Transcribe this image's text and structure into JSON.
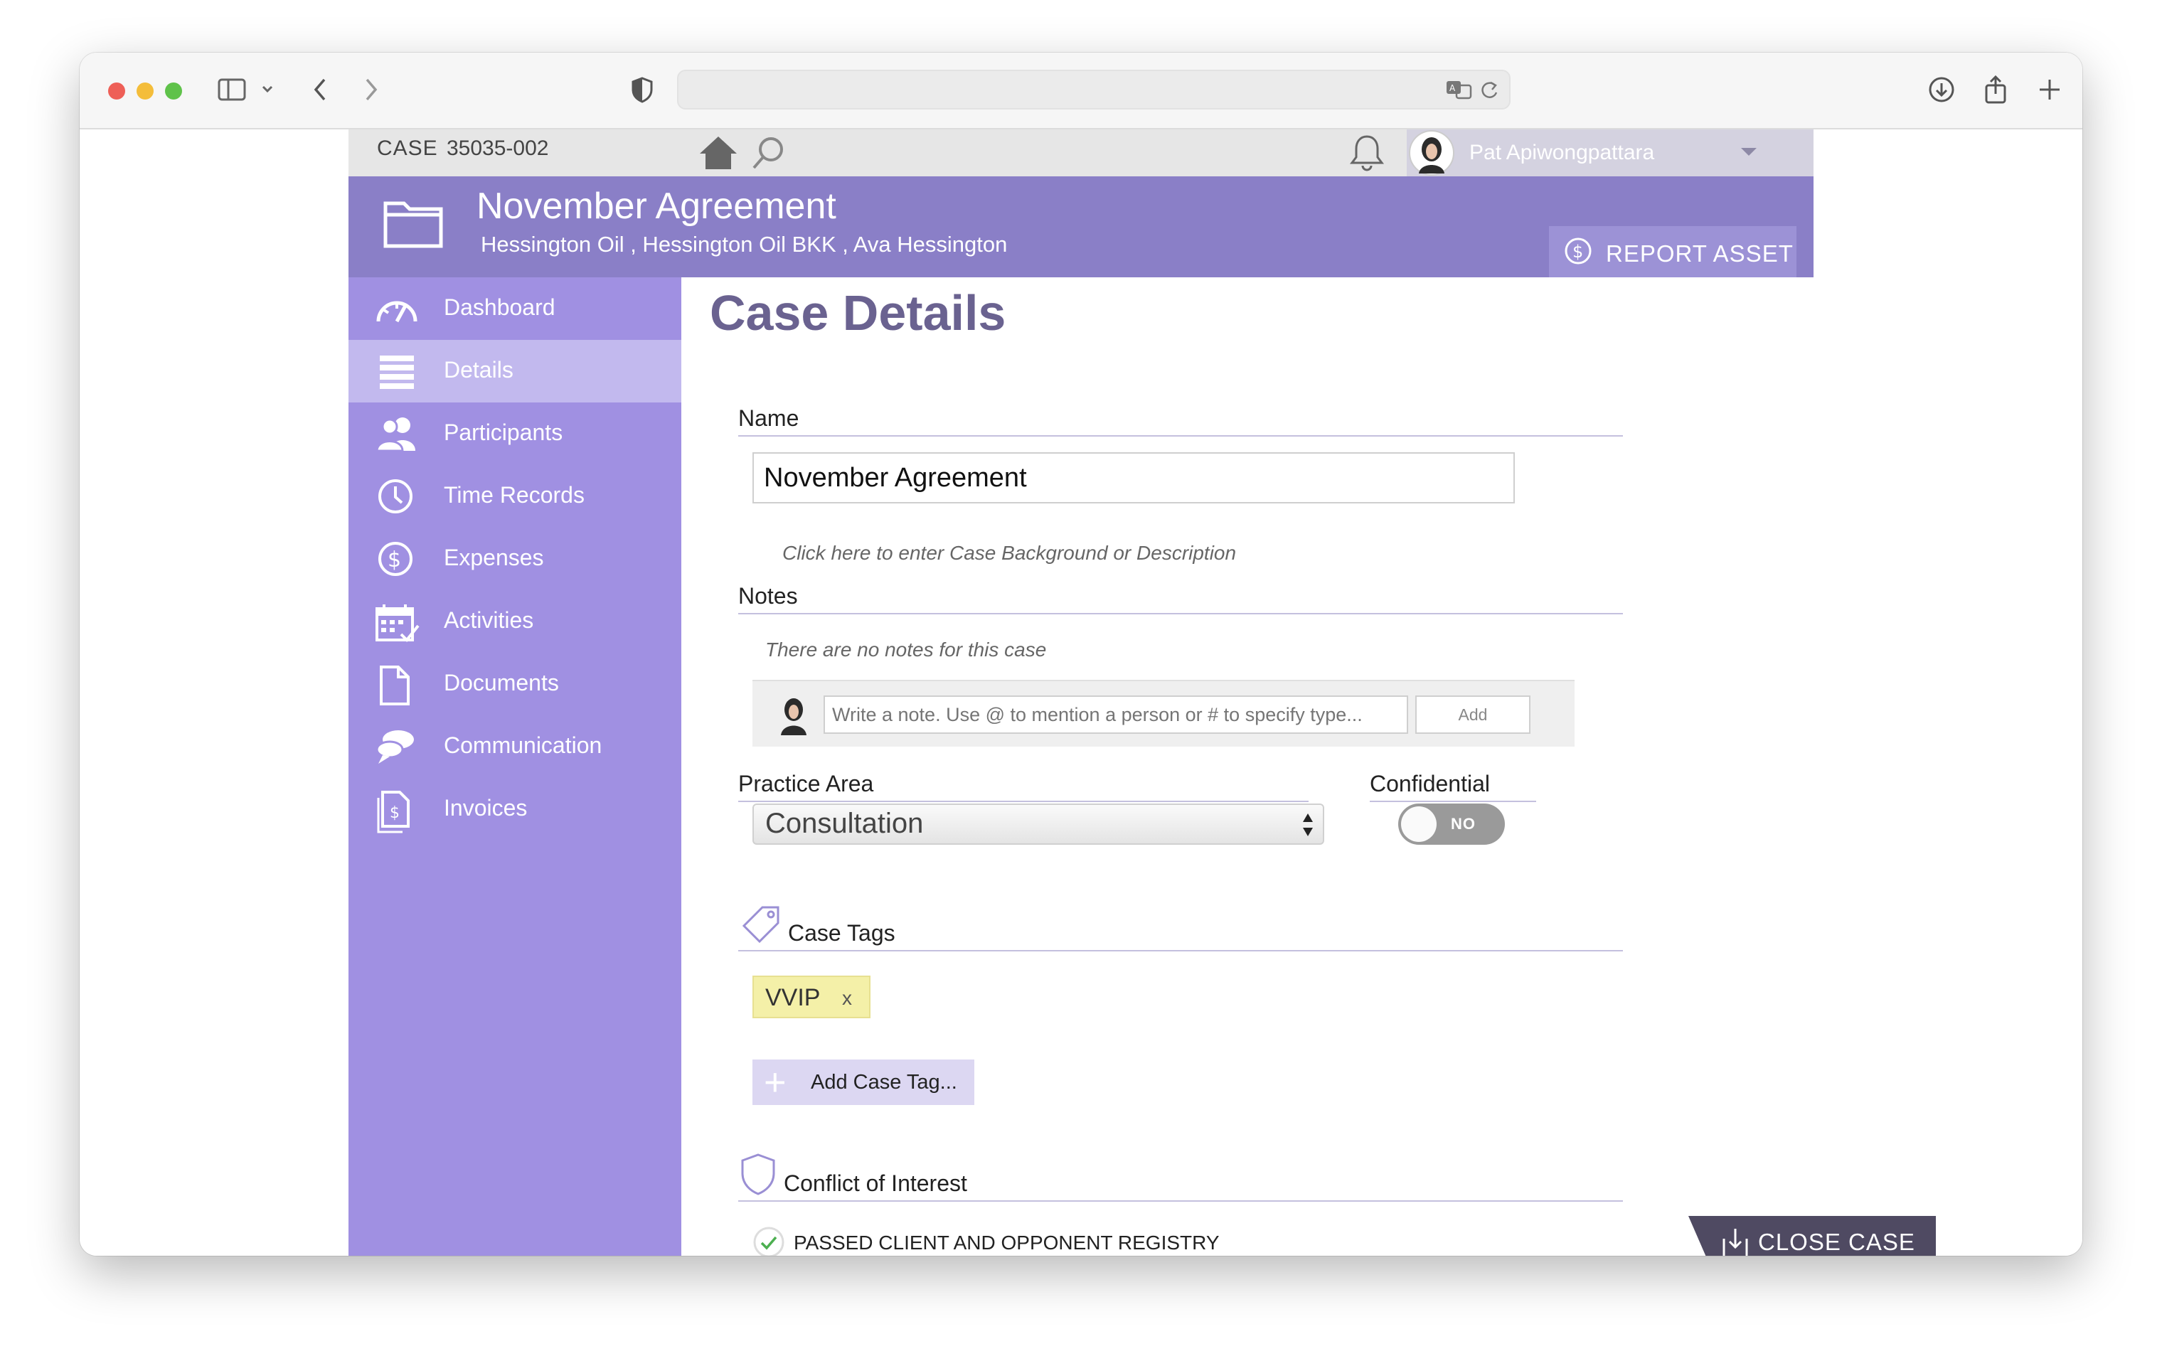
{
  "browser": {
    "icons": [
      "sidebar-toggle-icon",
      "chevron-down-icon",
      "back-arrow-icon",
      "forward-arrow-icon",
      "shield-icon",
      "translate-icon",
      "reload-icon",
      "download-icon",
      "share-icon",
      "new-tab-icon",
      "tabs-overview-icon"
    ]
  },
  "topbar": {
    "case_label": "CASE",
    "case_number": "35035-002",
    "user_name": "Pat Apiwongpattara"
  },
  "header": {
    "title": "November Agreement",
    "subtitle": "Hessington Oil ,  Hessington Oil BKK ,  Ava Hessington",
    "report_button": "REPORT ASSET"
  },
  "sidebar": {
    "items": [
      {
        "label": "Dashboard",
        "icon": "speedometer-icon"
      },
      {
        "label": "Details",
        "icon": "list-icon",
        "active": true
      },
      {
        "label": "Participants",
        "icon": "people-icon"
      },
      {
        "label": "Time Records",
        "icon": "clock-icon"
      },
      {
        "label": "Expenses",
        "icon": "dollar-circle-icon"
      },
      {
        "label": "Activities",
        "icon": "calendar-icon"
      },
      {
        "label": "Documents",
        "icon": "document-icon"
      },
      {
        "label": "Communication",
        "icon": "chat-bubble-icon"
      },
      {
        "label": "Invoices",
        "icon": "invoice-icon"
      }
    ]
  },
  "main": {
    "page_title": "Case Details",
    "name_label": "Name",
    "name_value": "November Agreement",
    "description_hint": "Click here to enter Case Background or Description",
    "notes_label": "Notes",
    "notes_empty": "There are no notes for this case",
    "note_placeholder": "Write a note. Use @ to mention a person or # to specify type...",
    "note_add": "Add",
    "practice_area_label": "Practice Area",
    "practice_area_value": "Consultation",
    "confidential_label": "Confidential",
    "confidential_value": "NO",
    "case_tags_label": "Case Tags",
    "tags": [
      {
        "name": "VVIP",
        "remove": "x"
      }
    ],
    "add_tag": "Add Case Tag...",
    "conflict_label": "Conflict of Interest",
    "conflict_status": "PASSED CLIENT AND OPPONENT REGISTRY",
    "close_case": "CLOSE CASE"
  },
  "colors": {
    "header": "#8a7fc7",
    "sidebar": "#a090e2",
    "sidebar_active": "#c2b9ee",
    "tag": "#f4f0a8",
    "close_case": "#4f4a62"
  }
}
